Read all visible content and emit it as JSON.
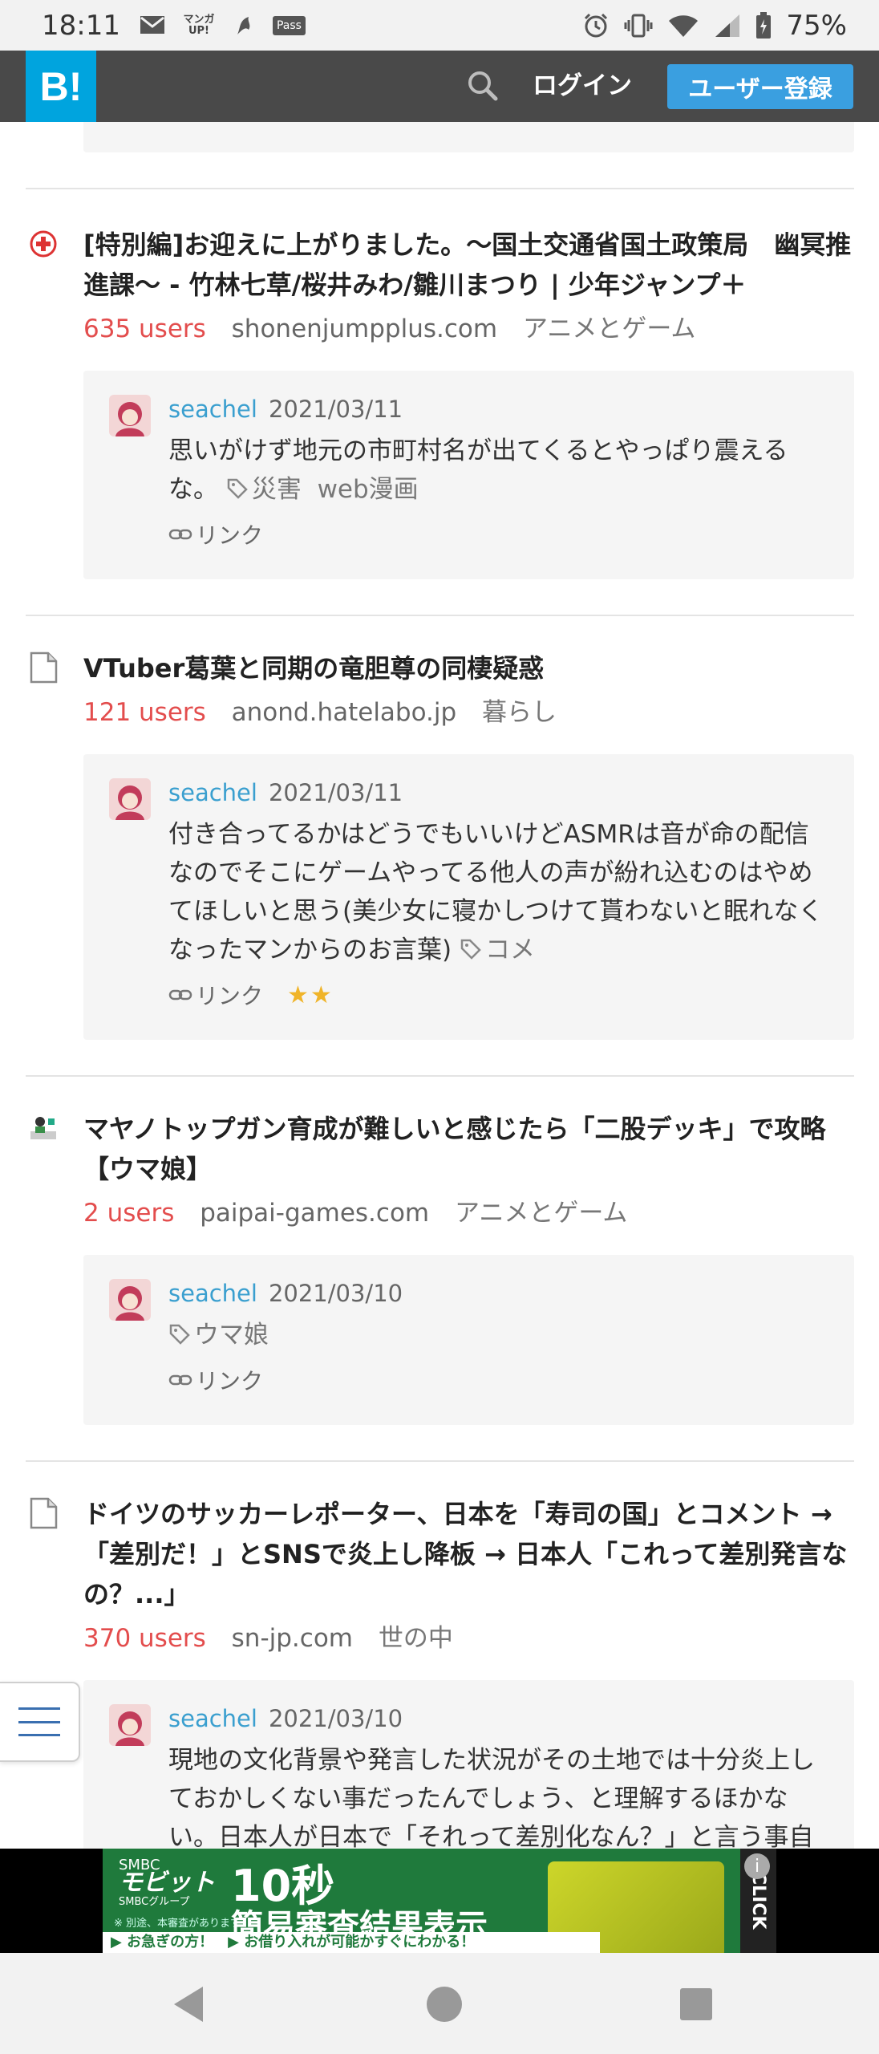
{
  "status_bar": {
    "time": "18:11",
    "icons": [
      "mail-icon",
      "manga-up-icon",
      "dolphin-icon",
      "pass-icon",
      "alarm-icon",
      "vibrate-icon",
      "wifi-icon",
      "signal-icon",
      "battery-icon"
    ],
    "manga_label": "マンガUP!",
    "pass_label": "Pass",
    "battery": "75%"
  },
  "header": {
    "logo": "B!",
    "login": "ログイン",
    "register": "ユーザー登録"
  },
  "entries": [
    {
      "favicon": "red-cross-icon",
      "title": "[特別編]お迎えに上がりました。〜国土交通省国土政策局　幽冥推進課〜 - 竹林七草/桜井みわ/雛川まつり | 少年ジャンプ＋",
      "users": "635 users",
      "domain": "shonenjumpplus.com",
      "category": "アニメとゲーム",
      "comment": {
        "user": "seachel",
        "date": "2021/03/11",
        "text": "思いがけず地元の市町村名が出てくるとやっぱり震えるな。",
        "tags": [
          "災害",
          "web漫画"
        ],
        "link": "リンク",
        "stars": ""
      }
    },
    {
      "favicon": "document-icon",
      "title": "VTuber葛葉と同期の竜胆尊の同棲疑惑",
      "users": "121 users",
      "domain": "anond.hatelabo.jp",
      "category": "暮らし",
      "comment": {
        "user": "seachel",
        "date": "2021/03/11",
        "text": "付き合ってるかはどうでもいいけどASMRは音が命の配信なのでそこにゲームやってる他人の声が紛れ込むのはやめてほしいと思う(美少女に寝かしつけて貰わないと眠れなくなったマンからのお言葉)",
        "tags": [
          "コメ"
        ],
        "link": "リンク",
        "stars": "★★"
      }
    },
    {
      "favicon": "game-site-icon",
      "title": "マヤノトップガン育成が難しいと感じたら「二股デッキ」で攻略【ウマ娘】",
      "users": "2 users",
      "domain": "paipai-games.com",
      "category": "アニメとゲーム",
      "comment": {
        "user": "seachel",
        "date": "2021/03/10",
        "text": "",
        "tags": [
          "ウマ娘"
        ],
        "link": "リンク",
        "stars": ""
      }
    },
    {
      "favicon": "document-icon",
      "title": "ドイツのサッカーレポーター、日本を「寿司の国」とコメント → 「差別だ！」とSNSで炎上し降板 → 日本人「これって差別発言なの？...」",
      "users": "370 users",
      "domain": "sn-jp.com",
      "category": "世の中",
      "comment": {
        "user": "seachel",
        "date": "2021/03/10",
        "text": "現地の文化背景や発言した状況がその土地では十分炎上しておかしくない事だったんでしょう、と理解するほかない。日本人が日本で「それって差別化なん？」と言う事自",
        "tags": [],
        "link": "",
        "stars": ""
      }
    }
  ],
  "ad": {
    "brand": "SMBC",
    "brand_name": "モビット",
    "brand_sub": "SMBCグループ",
    "headline1": "10秒",
    "headline2": "簡易審査結果表示",
    "note": "※ 別途、本審査があります",
    "bottom_text": "▶ お急ぎの方！　▶ お借り入れが可能かすぐにわかる！",
    "click": "CLICK"
  }
}
